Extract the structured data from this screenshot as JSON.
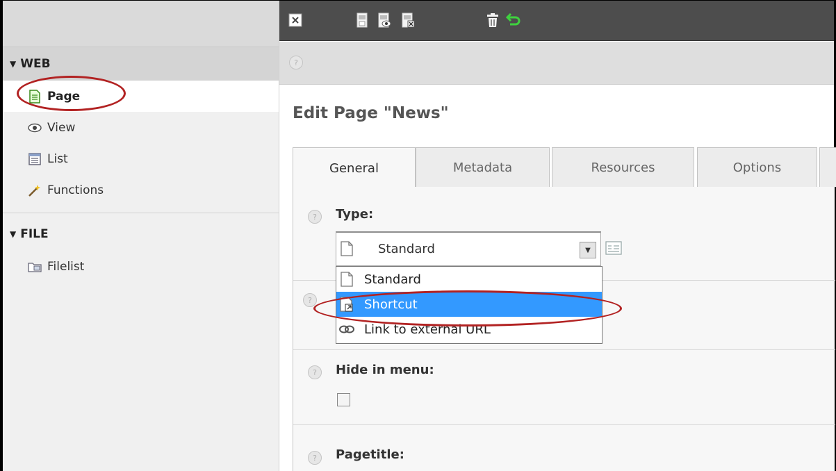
{
  "sidebar": {
    "groups": [
      {
        "label": "WEB",
        "items": [
          {
            "label": "Page",
            "icon": "page-icon",
            "active": true
          },
          {
            "label": "View",
            "icon": "eye-icon"
          },
          {
            "label": "List",
            "icon": "list-icon"
          },
          {
            "label": "Functions",
            "icon": "wand-icon"
          }
        ]
      },
      {
        "label": "FILE",
        "items": [
          {
            "label": "Filelist",
            "icon": "folder-icon"
          }
        ]
      }
    ]
  },
  "toolbar": {
    "buttons": [
      "close-icon",
      "save-icon",
      "save-view-icon",
      "save-close-icon",
      "delete-icon",
      "undo-icon"
    ]
  },
  "main": {
    "title": "Edit Page \"News\"",
    "tabs": [
      {
        "label": "General",
        "active": true
      },
      {
        "label": "Metadata"
      },
      {
        "label": "Resources"
      },
      {
        "label": "Options"
      }
    ],
    "fields": {
      "type_label": "Type:",
      "type_value": "Standard",
      "type_options": [
        {
          "label": "Standard",
          "icon": "document-icon"
        },
        {
          "label": "Shortcut",
          "icon": "shortcut-icon",
          "highlighted": true
        },
        {
          "label": "Link to external URL",
          "icon": "link-icon"
        }
      ],
      "hide_label": "Hide in menu:",
      "hide_checked": false,
      "pagetitle_label": "Pagetitle:"
    }
  },
  "colors": {
    "toolbar_bg": "#4d4d4d",
    "highlight": "#3399ff",
    "annotation": "#b22222"
  }
}
